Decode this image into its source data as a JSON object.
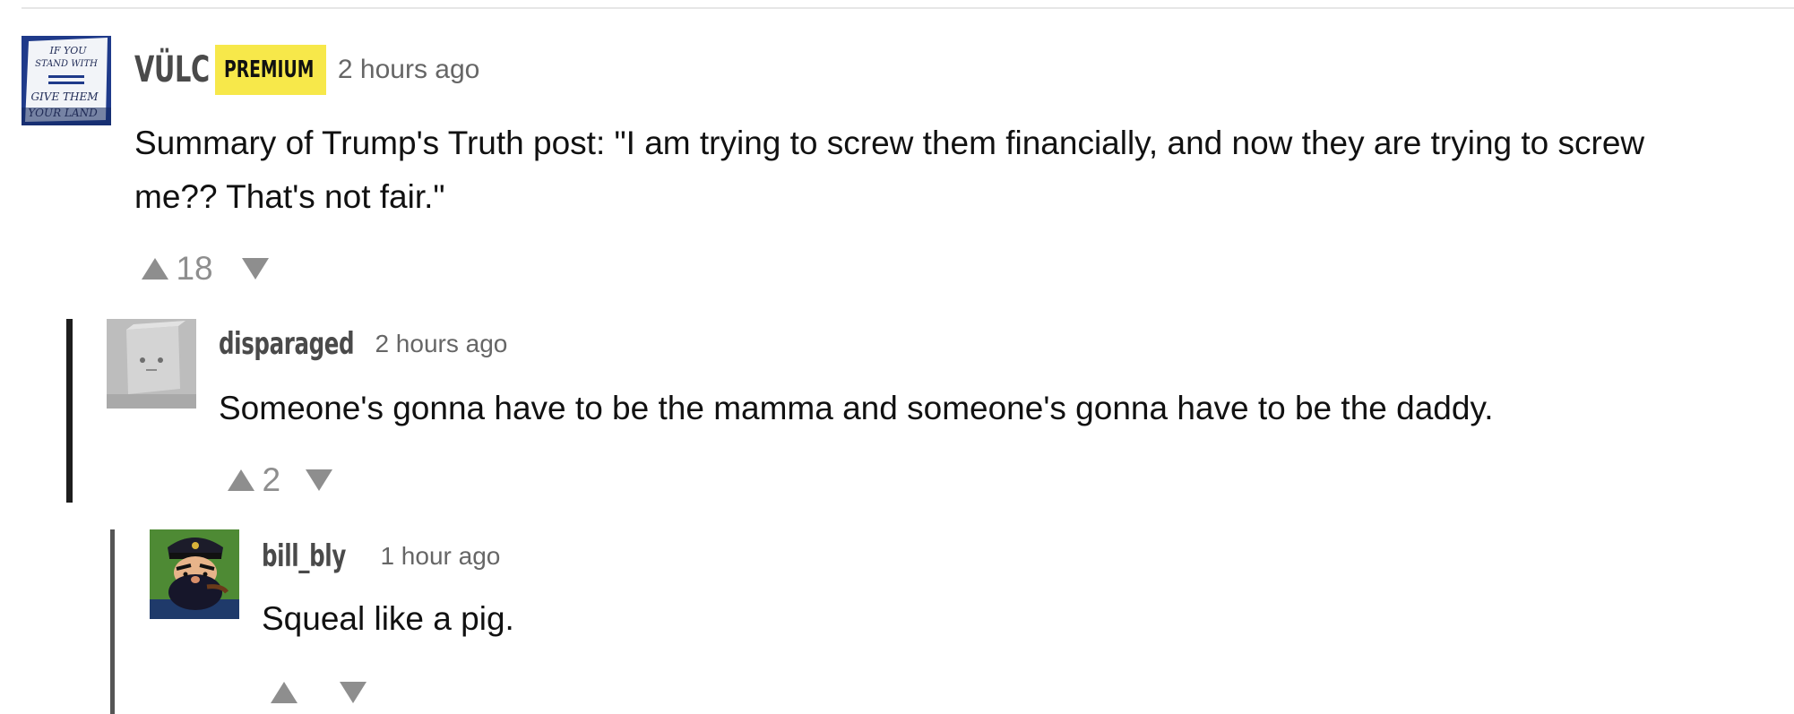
{
  "comments": [
    {
      "username": "VÜLC",
      "badge": "PREMIUM",
      "timestamp": "2 hours ago",
      "text_line1": "Summary of Trump's Truth post: \"I am trying to screw them financially, and now they are trying to screw",
      "text_line2": "me?? That's not fair.\"",
      "score": "18",
      "avatar_text": [
        "IF YOU",
        "STAND WITH",
        "GIVE THEM",
        "YOUR LAND"
      ]
    },
    {
      "username": "disparaged",
      "timestamp": "2 hours ago",
      "text": "Someone's gonna have to be the mamma and someone's gonna have to be the daddy.",
      "score": "2"
    },
    {
      "username": "bill_bly",
      "timestamp": "1 hour ago",
      "text": "Squeal like a pig.",
      "score": ""
    }
  ],
  "colors": {
    "premium_badge": "#f7e84a",
    "thread_bar_dark": "#1e1e1e",
    "thread_bar_gray": "#555555",
    "vote_arrow": "#8e8e8e",
    "timestamp": "#666666"
  },
  "icons": {
    "upvote": "upvote-arrow-icon",
    "downvote": "downvote-arrow-icon"
  }
}
